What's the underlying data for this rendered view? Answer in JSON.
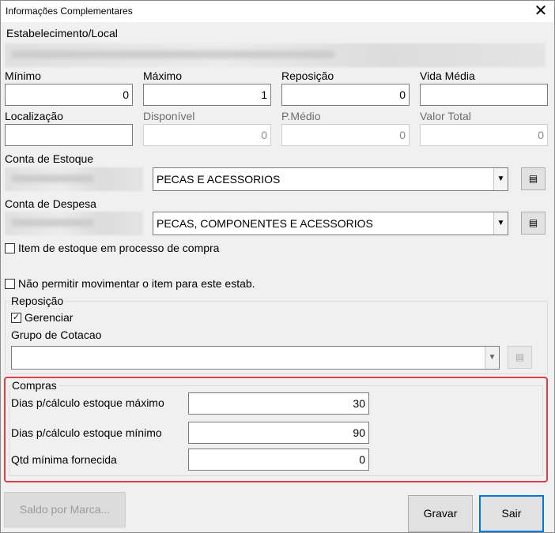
{
  "window": {
    "title": "Informações Complementares",
    "close_label": "✕"
  },
  "estabelecimento": {
    "label": "Estabelecimento/Local"
  },
  "row1": {
    "minimo": {
      "label": "Mínimo",
      "value": "0"
    },
    "maximo": {
      "label": "Máximo",
      "value": "1"
    },
    "reposicao": {
      "label": "Reposição",
      "value": "0"
    },
    "vida_media": {
      "label": "Vida Média",
      "value": ""
    }
  },
  "row2": {
    "localizacao": {
      "label": "Localização",
      "value": ""
    },
    "disponivel": {
      "label": "Disponível",
      "value": "0"
    },
    "pmedio": {
      "label": "P.Médio",
      "value": "0"
    },
    "valor_total": {
      "label": "Valor Total",
      "value": "0"
    }
  },
  "conta_estoque": {
    "label": "Conta de Estoque",
    "selected": "PECAS E ACESSORIOS"
  },
  "conta_despesa": {
    "label": "Conta de Despesa",
    "selected": "PECAS, COMPONENTES E ACESSORIOS"
  },
  "checks": {
    "item_estoque": {
      "label": "Item de estoque em processo de compra",
      "checked": false
    },
    "nao_permitir": {
      "label": "Não permitir movimentar o item para este estab.",
      "checked": false
    }
  },
  "reposicao_group": {
    "title": "Reposição",
    "gerenciar": {
      "label": "Gerenciar",
      "checked": true
    },
    "grupo_label": "Grupo de Cotacao",
    "grupo_value": ""
  },
  "compras": {
    "title": "Compras",
    "dias_max": {
      "label": "Dias p/cálculo estoque máximo",
      "value": "30"
    },
    "dias_min": {
      "label": "Dias p/cálculo estoque mínimo",
      "value": "90"
    },
    "qtd_min": {
      "label": "Qtd mínima fornecida",
      "value": "0"
    }
  },
  "buttons": {
    "saldo": "Saldo por Marca...",
    "gravar": "Gravar",
    "sair": "Sair"
  },
  "icons": {
    "list": "list-icon",
    "check": "checkmark-icon",
    "arrow": "chevron-down-icon"
  },
  "colors": {
    "highlight": "#d9414c",
    "default_button_border": "#0078d7"
  }
}
